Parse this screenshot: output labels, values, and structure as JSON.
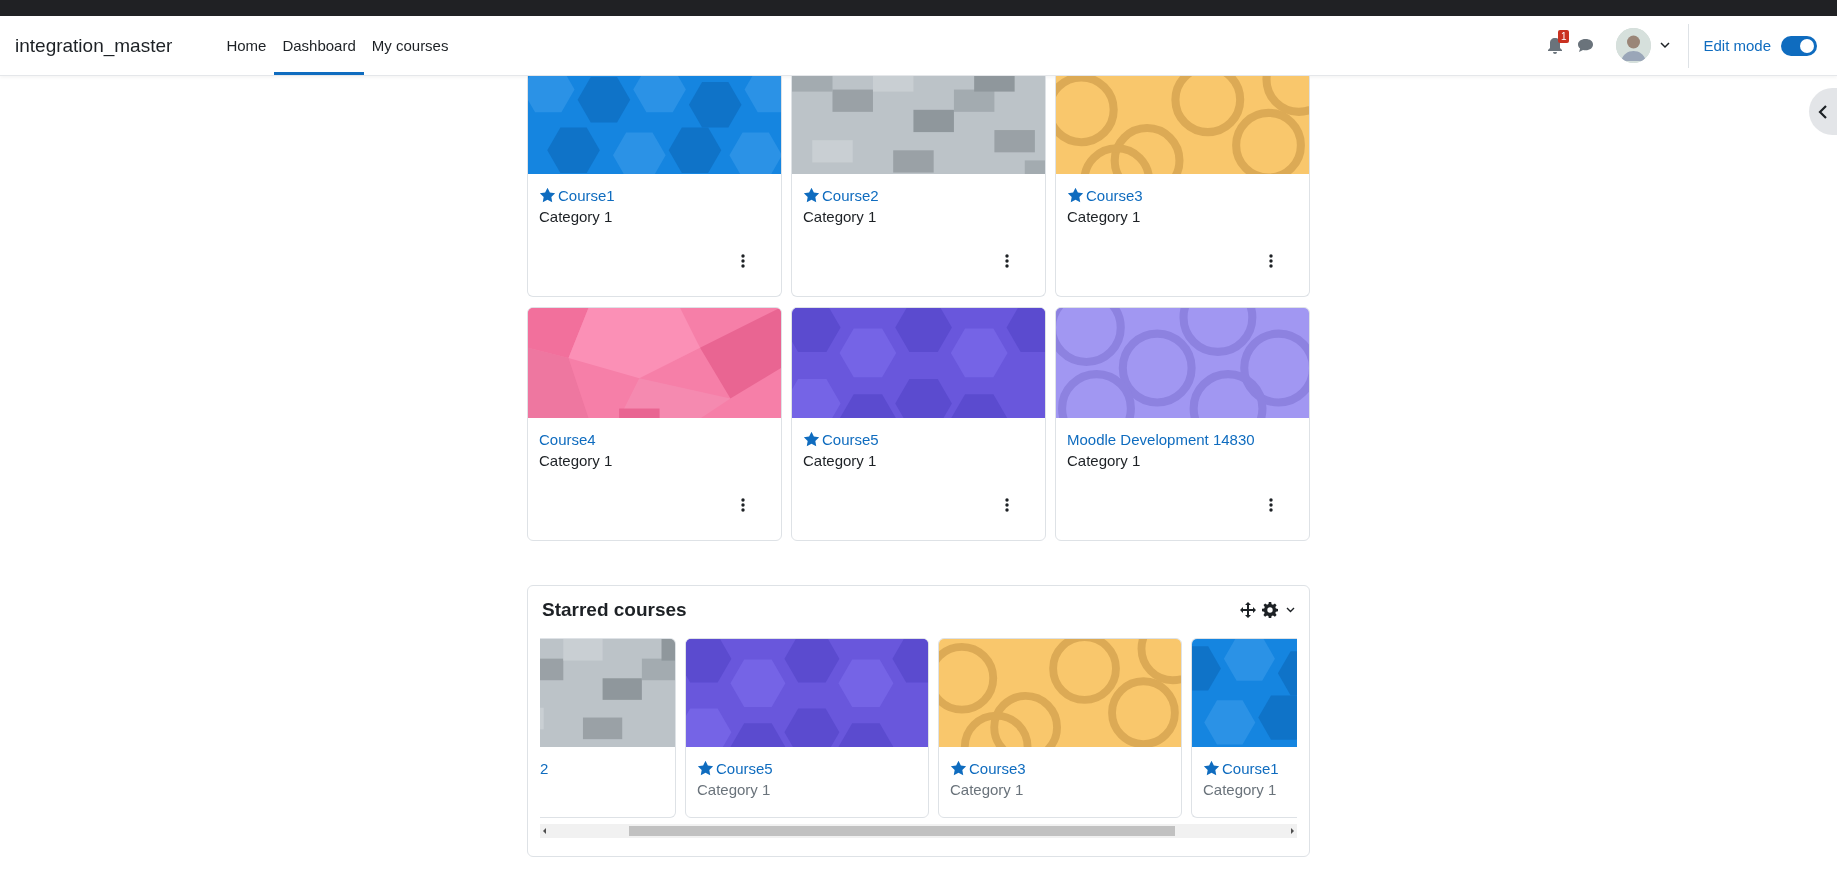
{
  "site_name": "integration_master",
  "nav": [
    {
      "label": "Home",
      "selected": false
    },
    {
      "label": "Dashboard",
      "selected": true
    },
    {
      "label": "My courses",
      "selected": false
    }
  ],
  "notifications": {
    "count": "1"
  },
  "edit_mode": {
    "label": "Edit mode",
    "on": true
  },
  "courses": [
    {
      "name": "Course1",
      "category": "Category 1",
      "starred": true
    },
    {
      "name": "Course2",
      "category": "Category 1",
      "starred": true
    },
    {
      "name": "Course3",
      "category": "Category 1",
      "starred": true
    },
    {
      "name": "Course4",
      "category": "Category 1",
      "starred": false
    },
    {
      "name": "Course5",
      "category": "Category 1",
      "starred": true
    },
    {
      "name": "Moodle Development 14830",
      "category": "Category 1",
      "starred": false
    }
  ],
  "starred_courses": {
    "title": "Starred courses",
    "items": [
      {
        "kind": "clipped",
        "name": "2"
      },
      {
        "kind": "card",
        "name": "Course5",
        "category": "Category 1",
        "starred": true
      },
      {
        "kind": "card",
        "name": "Course3",
        "category": "Category 1",
        "starred": true
      },
      {
        "kind": "card",
        "name": "Course1",
        "category": "Category 1",
        "starred": true
      }
    ]
  }
}
